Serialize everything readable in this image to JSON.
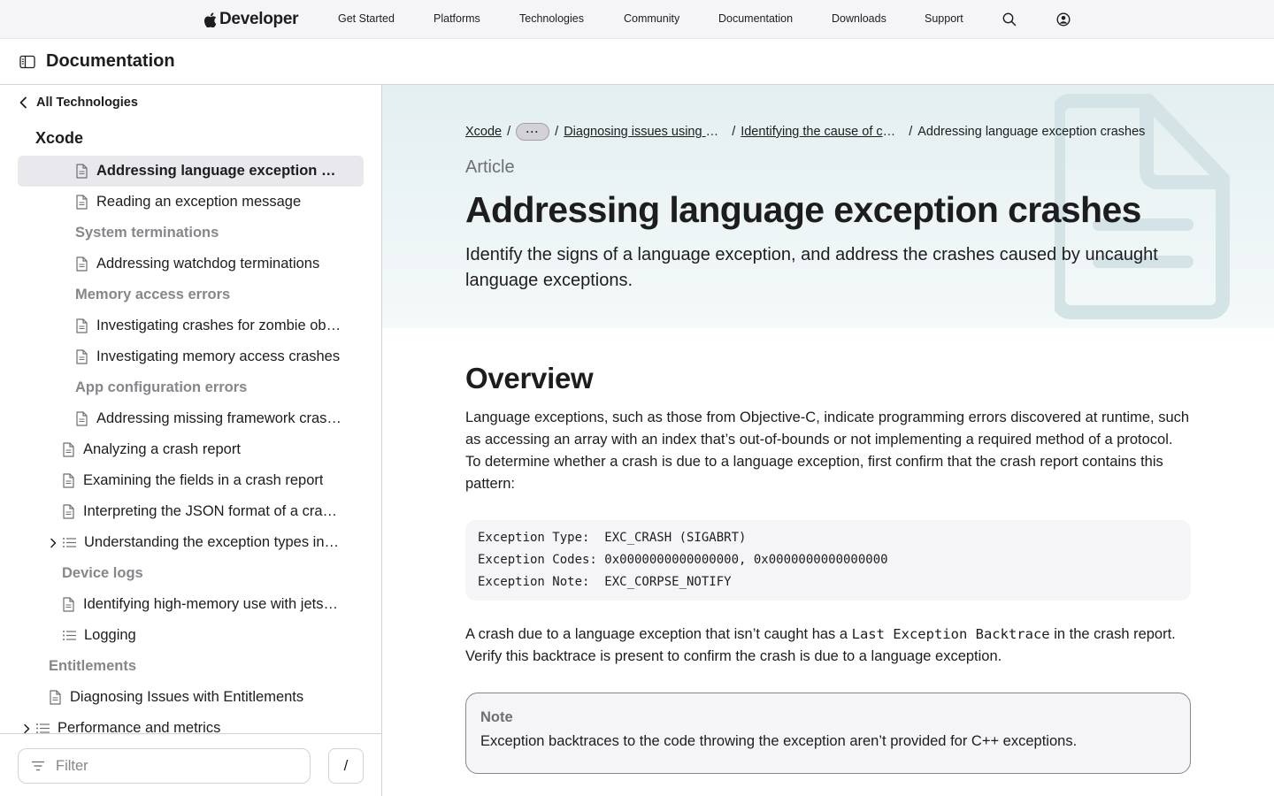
{
  "globalnav": {
    "logo_text": "Developer",
    "links": [
      "Get Started",
      "Platforms",
      "Technologies",
      "Community",
      "Documentation",
      "Downloads",
      "Support"
    ]
  },
  "docheader": {
    "title": "Documentation"
  },
  "sidebar": {
    "back_label": "All Technologies",
    "section_title": "Xcode",
    "items": [
      {
        "label": "Addressing language exception crashes",
        "kind": "doc"
      },
      {
        "label": "Reading an exception message",
        "kind": "doc"
      },
      {
        "label": "System terminations",
        "kind": "group"
      },
      {
        "label": "Addressing watchdog terminations",
        "kind": "doc"
      },
      {
        "label": "Memory access errors",
        "kind": "group"
      },
      {
        "label": "Investigating crashes for zombie objects",
        "kind": "doc"
      },
      {
        "label": "Investigating memory access crashes",
        "kind": "doc"
      },
      {
        "label": "App configuration errors",
        "kind": "group"
      },
      {
        "label": "Addressing missing framework crashes",
        "kind": "doc"
      },
      {
        "label": "Analyzing a crash report",
        "kind": "doc"
      },
      {
        "label": "Examining the fields in a crash report",
        "kind": "doc"
      },
      {
        "label": "Interpreting the JSON format of a crash report",
        "kind": "doc"
      },
      {
        "label": "Understanding the exception types in a crash report",
        "kind": "list"
      },
      {
        "label": "Device logs",
        "kind": "group"
      },
      {
        "label": "Identifying high-memory use with jetsam event reports",
        "kind": "doc"
      },
      {
        "label": "Logging",
        "kind": "list"
      },
      {
        "label": "Entitlements",
        "kind": "group"
      },
      {
        "label": "Diagnosing Issues with Entitlements",
        "kind": "doc"
      },
      {
        "label": "Performance and metrics",
        "kind": "list"
      }
    ],
    "filter_placeholder": "Filter",
    "filter_shortcut": "/"
  },
  "breadcrumbs": {
    "items": [
      "Xcode",
      "Diagnosing issues using crash reports and device logs",
      "Identifying the cause of common crashes"
    ],
    "more": "···",
    "current": "Addressing language exception crashes"
  },
  "article": {
    "eyebrow": "Article",
    "title": "Addressing language exception crashes",
    "abstract": "Identify the signs of a language exception, and address the crashes caused by uncaught language exceptions."
  },
  "overview": {
    "heading": "Overview",
    "para1": "Language exceptions, such as those from Objective-C, indicate programming errors discovered at runtime, such as accessing an array with an index that’s out-of-bounds or not implementing a required method of a protocol. To determine whether a crash is due to a language exception, first confirm that the crash report contains this pattern:",
    "code_lines": [
      "Exception Type:  EXC_CRASH (SIGABRT)",
      "Exception Codes: 0x0000000000000000, 0x0000000000000000",
      "Exception Note:  EXC_CORPSE_NOTIFY"
    ],
    "para2_before": "A crash due to a language exception that isn’t caught has a ",
    "para2_code": "Last Exception Backtrace",
    "para2_after": " in the crash report. Verify this backtrace is present to confirm the crash is due to a language exception.",
    "note_title": "Note",
    "note_body": "Exception backtraces to the code throwing the exception aren’t provided for C++ exceptions."
  }
}
